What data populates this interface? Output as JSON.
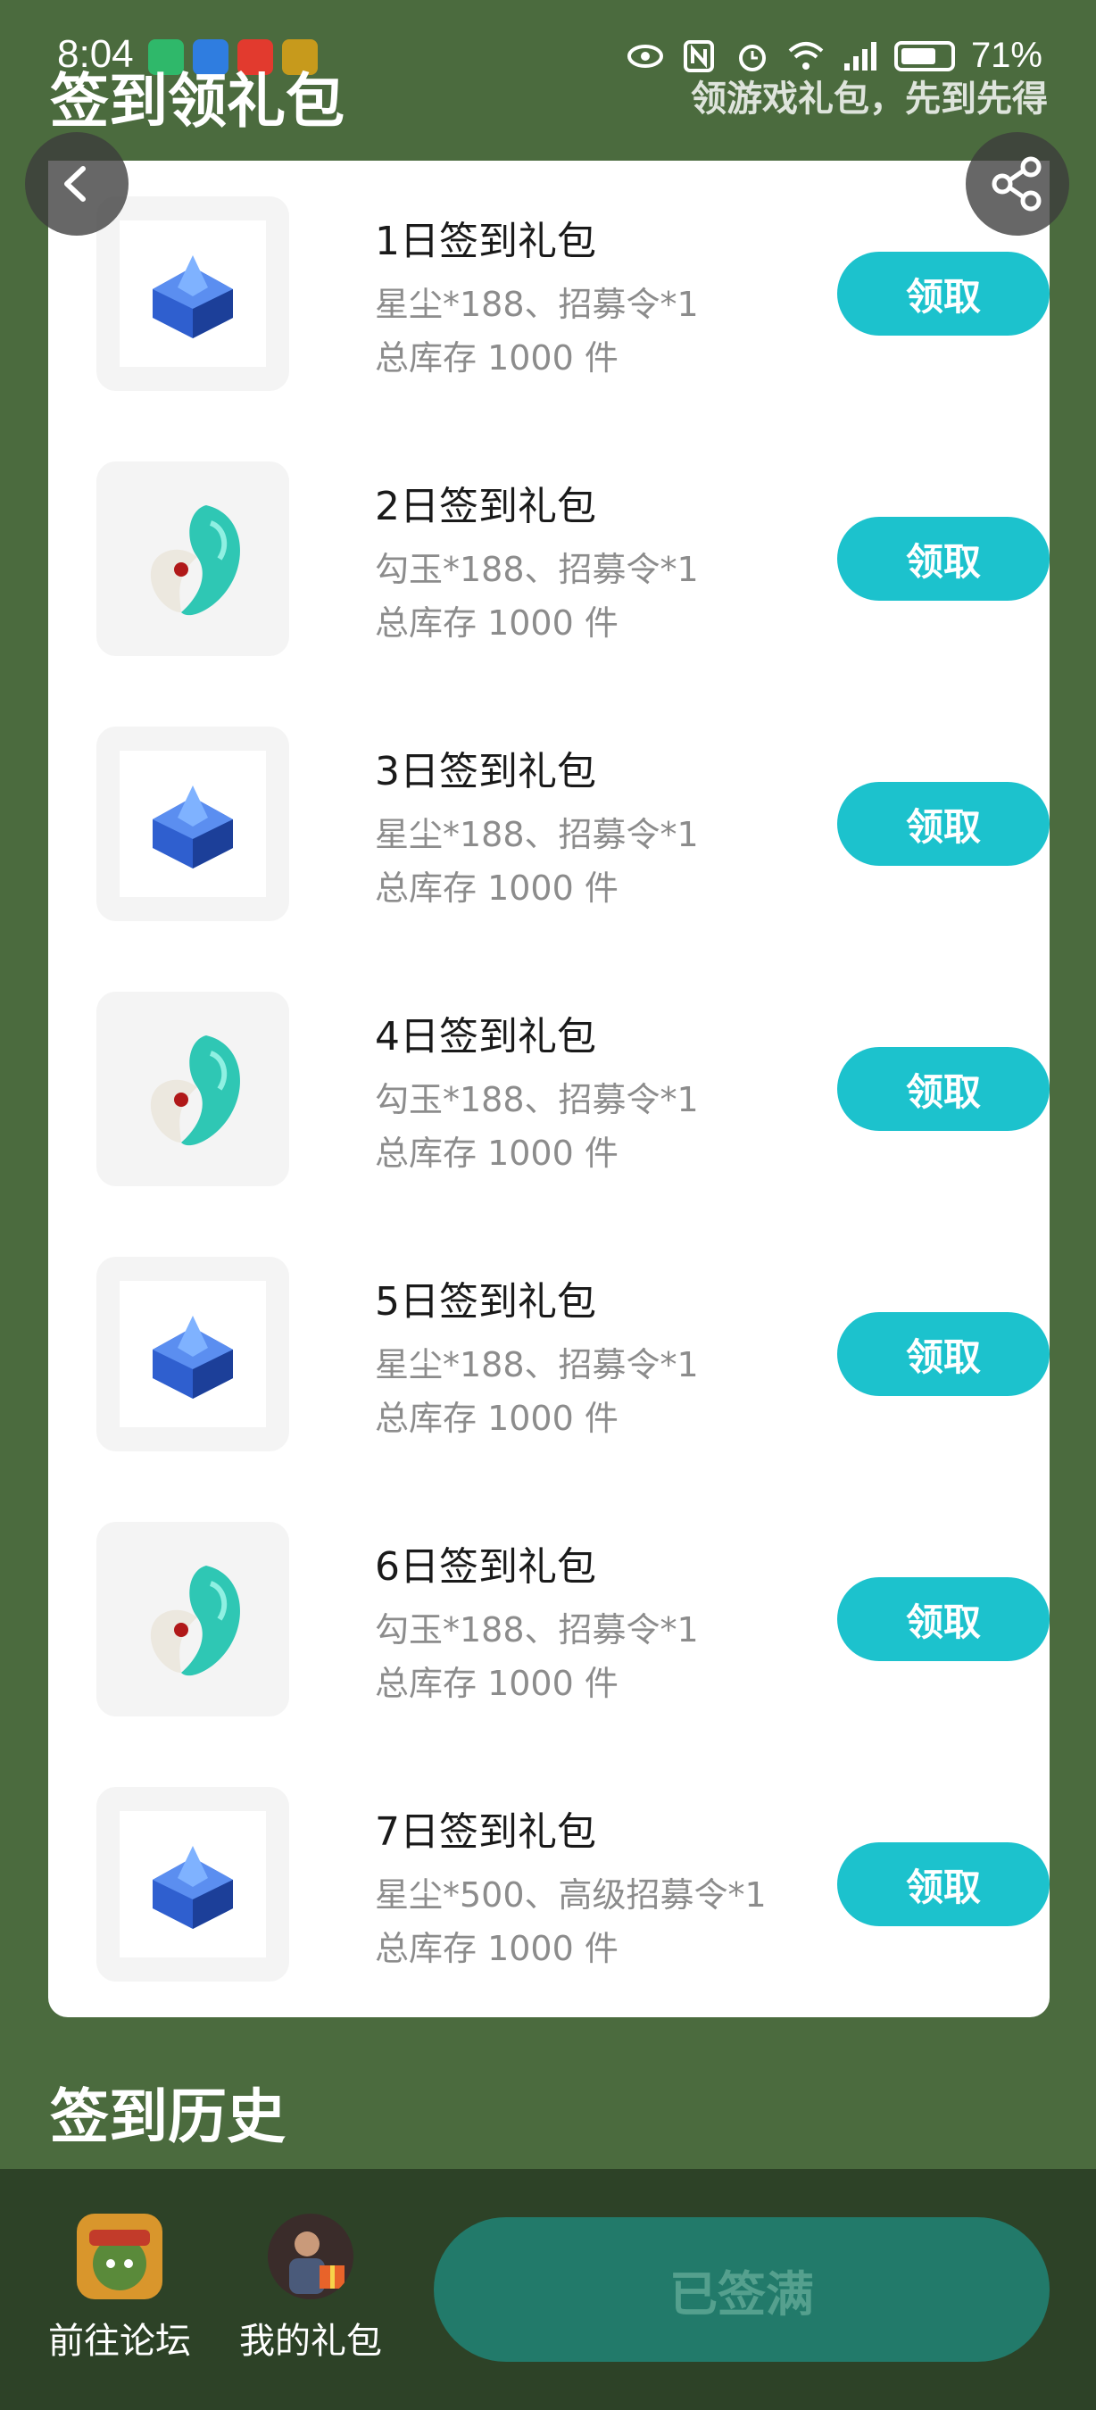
{
  "status_bar": {
    "time": "8:04",
    "battery": "71%"
  },
  "header": {
    "title": "签到领礼包",
    "subtitle": "领游戏礼包，先到先得"
  },
  "gifts": [
    {
      "name": "1日签到礼包",
      "desc": "星尘*188、招募令*1",
      "stock": "总库存 1000 件",
      "button": "领取",
      "icon": "crystal-chest-icon"
    },
    {
      "name": "2日签到礼包",
      "desc": "勾玉*188、招募令*1",
      "stock": "总库存 1000 件",
      "button": "领取",
      "icon": "magatama-icon"
    },
    {
      "name": "3日签到礼包",
      "desc": "星尘*188、招募令*1",
      "stock": "总库存 1000 件",
      "button": "领取",
      "icon": "crystal-chest-icon"
    },
    {
      "name": "4日签到礼包",
      "desc": "勾玉*188、招募令*1",
      "stock": "总库存 1000 件",
      "button": "领取",
      "icon": "magatama-icon"
    },
    {
      "name": "5日签到礼包",
      "desc": "星尘*188、招募令*1",
      "stock": "总库存 1000 件",
      "button": "领取",
      "icon": "crystal-chest-icon"
    },
    {
      "name": "6日签到礼包",
      "desc": "勾玉*188、招募令*1",
      "stock": "总库存 1000 件",
      "button": "领取",
      "icon": "magatama-icon"
    },
    {
      "name": "7日签到礼包",
      "desc": "星尘*500、高级招募令*1",
      "stock": "总库存 1000 件",
      "button": "领取",
      "icon": "crystal-chest-icon"
    }
  ],
  "history": {
    "title": "签到历史"
  },
  "bottom_bar": {
    "forum_label": "前往论坛",
    "my_gifts_label": "我的礼包",
    "signed_label": "已签满"
  },
  "colors": {
    "background": "#4b6b3e",
    "accent": "#1cc2cd",
    "bottom_bar": "#2d4227",
    "signed_button": "#227a6a"
  }
}
